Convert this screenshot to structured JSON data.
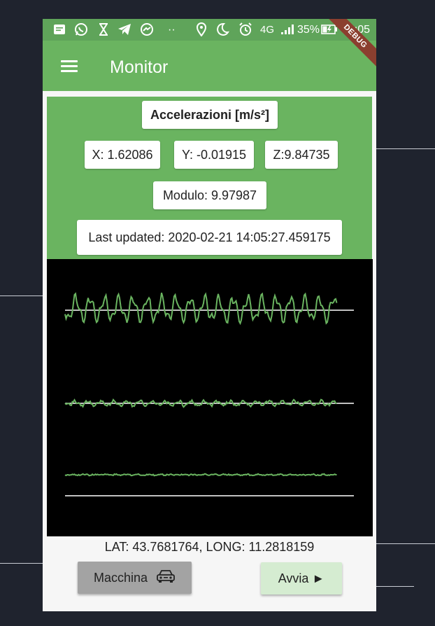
{
  "status_bar": {
    "battery": "35%",
    "time": "14:05",
    "network": "4G",
    "dots": "··",
    "icons": [
      "notification-icon",
      "whatsapp-icon",
      "hourglass-icon",
      "telegram-icon",
      "messenger-icon",
      "location-icon",
      "night-mode-icon",
      "alarm-icon",
      "signal-icon",
      "battery-charging-icon"
    ]
  },
  "debug_banner": "DEBUG",
  "app_bar": {
    "title": "Monitor",
    "menu_icon": "hamburger-menu-icon"
  },
  "acceleration": {
    "header": "Accelerazioni  [m/s²]",
    "x": "X: 1.62086",
    "y": "Y: -0.01915",
    "z": "Z:9.84735",
    "modulo": "Modulo: 9.97987",
    "last_updated": "Last updated: 2020-02-21 14:05:27.459175"
  },
  "chart_data": {
    "type": "line",
    "series": [
      {
        "axis": "x",
        "character": "oscillating, amplitude high"
      },
      {
        "axis": "y",
        "character": "oscillating, amplitude low"
      },
      {
        "axis": "z",
        "character": "nearly flat"
      }
    ],
    "grid": false,
    "background": "#000000",
    "line_color": "#6ab460",
    "baseline_color": "#ffffff"
  },
  "location": {
    "text": "LAT: 43.7681764, LONG: 11.2818159"
  },
  "buttons": {
    "machine_label": "Macchina",
    "machine_icon": "car-icon",
    "start_label": "Avvia ►"
  },
  "colors": {
    "primary": "#6ab460",
    "status_bar": "#5fa45a",
    "debug_ribbon": "#8b3f2f"
  }
}
